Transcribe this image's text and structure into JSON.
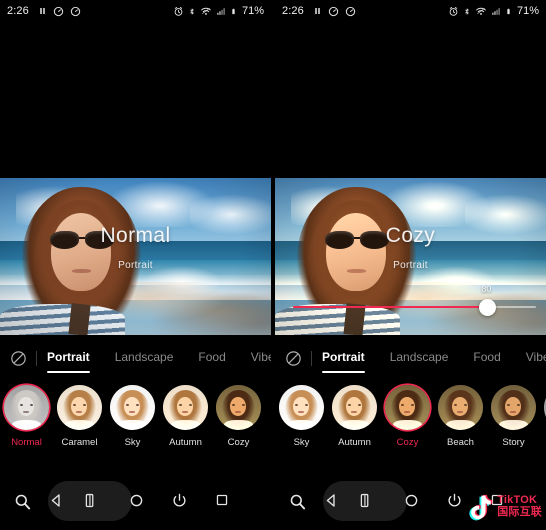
{
  "status_bar": {
    "time": "2:26",
    "left_icons": [
      "pause-icon",
      "speedometer-icon",
      "speedometer-icon"
    ],
    "right_icons": [
      "alarm-icon",
      "bluetooth-icon",
      "wifi-icon",
      "signal-icon",
      "battery-icon"
    ],
    "battery_percent": "71%"
  },
  "panels": [
    {
      "id": "left",
      "photo": {
        "overlay_title": "Normal",
        "overlay_subtitle": "Portrait",
        "scene": "beach-selfie-photo"
      },
      "slider": {
        "visible": false,
        "value": "",
        "percent": 0
      },
      "tabs": {
        "no_filter_icon": "no-filter-icon",
        "items": [
          {
            "label": "Portrait",
            "active": true
          },
          {
            "label": "Landscape",
            "active": false
          },
          {
            "label": "Food",
            "active": false
          },
          {
            "label": "Vibe",
            "active": false
          }
        ]
      },
      "filters": [
        {
          "label": "Normal",
          "selected": true,
          "tone": "normal"
        },
        {
          "label": "Caramel",
          "selected": false,
          "tone": "caramel"
        },
        {
          "label": "Sky",
          "selected": false,
          "tone": "sky"
        },
        {
          "label": "Autumn",
          "selected": false,
          "tone": "autumn"
        },
        {
          "label": "Cozy",
          "selected": false,
          "tone": "cozy"
        }
      ]
    },
    {
      "id": "right",
      "photo": {
        "overlay_title": "Cozy",
        "overlay_subtitle": "Portrait",
        "scene": "beach-selfie-photo-warm"
      },
      "slider": {
        "visible": true,
        "value": "80",
        "percent": 80
      },
      "tabs": {
        "no_filter_icon": "no-filter-icon",
        "items": [
          {
            "label": "Portrait",
            "active": true
          },
          {
            "label": "Landscape",
            "active": false
          },
          {
            "label": "Food",
            "active": false
          },
          {
            "label": "Vibe",
            "active": false
          }
        ]
      },
      "filters": [
        {
          "label": "Sky",
          "selected": false,
          "tone": "sky"
        },
        {
          "label": "Autumn",
          "selected": false,
          "tone": "autumn"
        },
        {
          "label": "Cozy",
          "selected": true,
          "tone": "cozy"
        },
        {
          "label": "Beach",
          "selected": false,
          "tone": "beach"
        },
        {
          "label": "Story",
          "selected": false,
          "tone": "story"
        },
        {
          "label": "",
          "selected": false,
          "tone": "partial"
        }
      ]
    }
  ],
  "nav_bar": {
    "items": [
      {
        "name": "search-icon"
      },
      {
        "name": "back-icon"
      },
      {
        "name": "screenshot-icon"
      },
      {
        "name": "home-icon"
      },
      {
        "name": "power-icon"
      },
      {
        "name": "recents-icon"
      }
    ]
  },
  "watermark": {
    "line1": "TikTOK",
    "line2": "国际互联",
    "color": "#ef2950"
  },
  "colors": {
    "accent": "#ef2950",
    "background": "#000000",
    "tab_inactive": "#8a8a8a"
  }
}
